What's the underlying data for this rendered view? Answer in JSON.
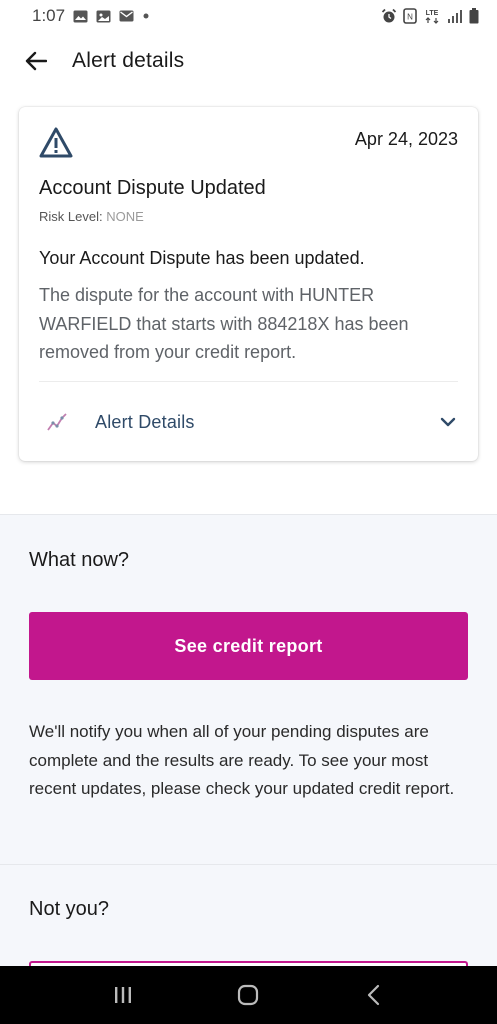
{
  "status_bar": {
    "time": "1:07",
    "left_icons": [
      "image-icon",
      "gallery-icon",
      "mail-icon",
      "dot-icon"
    ],
    "right_icons": [
      "alarm-icon",
      "nfc-icon",
      "lte-icon",
      "signal-icon",
      "battery-icon"
    ],
    "network": "LTE"
  },
  "header": {
    "title": "Alert details"
  },
  "alert_card": {
    "date": "Apr 24, 2023",
    "title": "Account Dispute Updated",
    "risk_label": "Risk Level:",
    "risk_value": "NONE",
    "summary": "Your Account Dispute has been updated.",
    "body": "The dispute for the account with HUNTER WARFIELD that starts with 884218X has been removed from your credit report.",
    "details_label": "Alert Details"
  },
  "what_now": {
    "title": "What now?",
    "button_label": "See credit report",
    "notify_text": "We'll notify you when all of your pending disputes are complete and the results are ready. To see your most recent updates, please check your updated credit report."
  },
  "not_you": {
    "title": "Not you?"
  },
  "colors": {
    "accent": "#c2178d",
    "link_blue": "#2f4a68",
    "warning_icon": "#2f4a68",
    "section_bg": "#f5f7fb"
  }
}
